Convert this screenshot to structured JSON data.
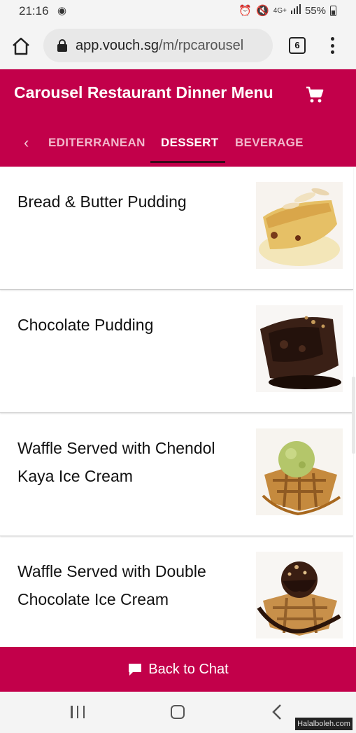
{
  "status_bar": {
    "time": "21:16",
    "notification_icon": "camera-icon",
    "right_icons": [
      "alarm-icon",
      "mute-icon",
      "signal-icon"
    ],
    "network": "4G+",
    "battery": "55%"
  },
  "browser": {
    "url_host": "app.vouch.sg",
    "url_path": "/m/rpcarousel",
    "tab_count": "6"
  },
  "header": {
    "title": "Carousel Restaurant Dinner Menu",
    "cart_icon": "shopping-cart-icon"
  },
  "tabs": {
    "items": [
      {
        "label": "EDITERRANEAN",
        "active": false
      },
      {
        "label": "DESSERT",
        "active": true
      },
      {
        "label": "BEVERAGE",
        "active": false
      }
    ]
  },
  "menu": {
    "items": [
      {
        "name": "Bread & Butter Pudding",
        "image": "bread-butter-pudding-photo"
      },
      {
        "name": "Chocolate Pudding",
        "image": "chocolate-pudding-photo"
      },
      {
        "name": "Waffle Served with Chendol Kaya Ice Cream",
        "image": "waffle-chendol-photo"
      },
      {
        "name": "Waffle Served with Double Chocolate Ice Cream",
        "image": "waffle-chocolate-photo"
      }
    ]
  },
  "footer": {
    "label": "Back to Chat"
  },
  "watermark": "Halalboleh.com",
  "colors": {
    "brand": "#c2004a",
    "tab_indicator": "#3a0a1a"
  }
}
